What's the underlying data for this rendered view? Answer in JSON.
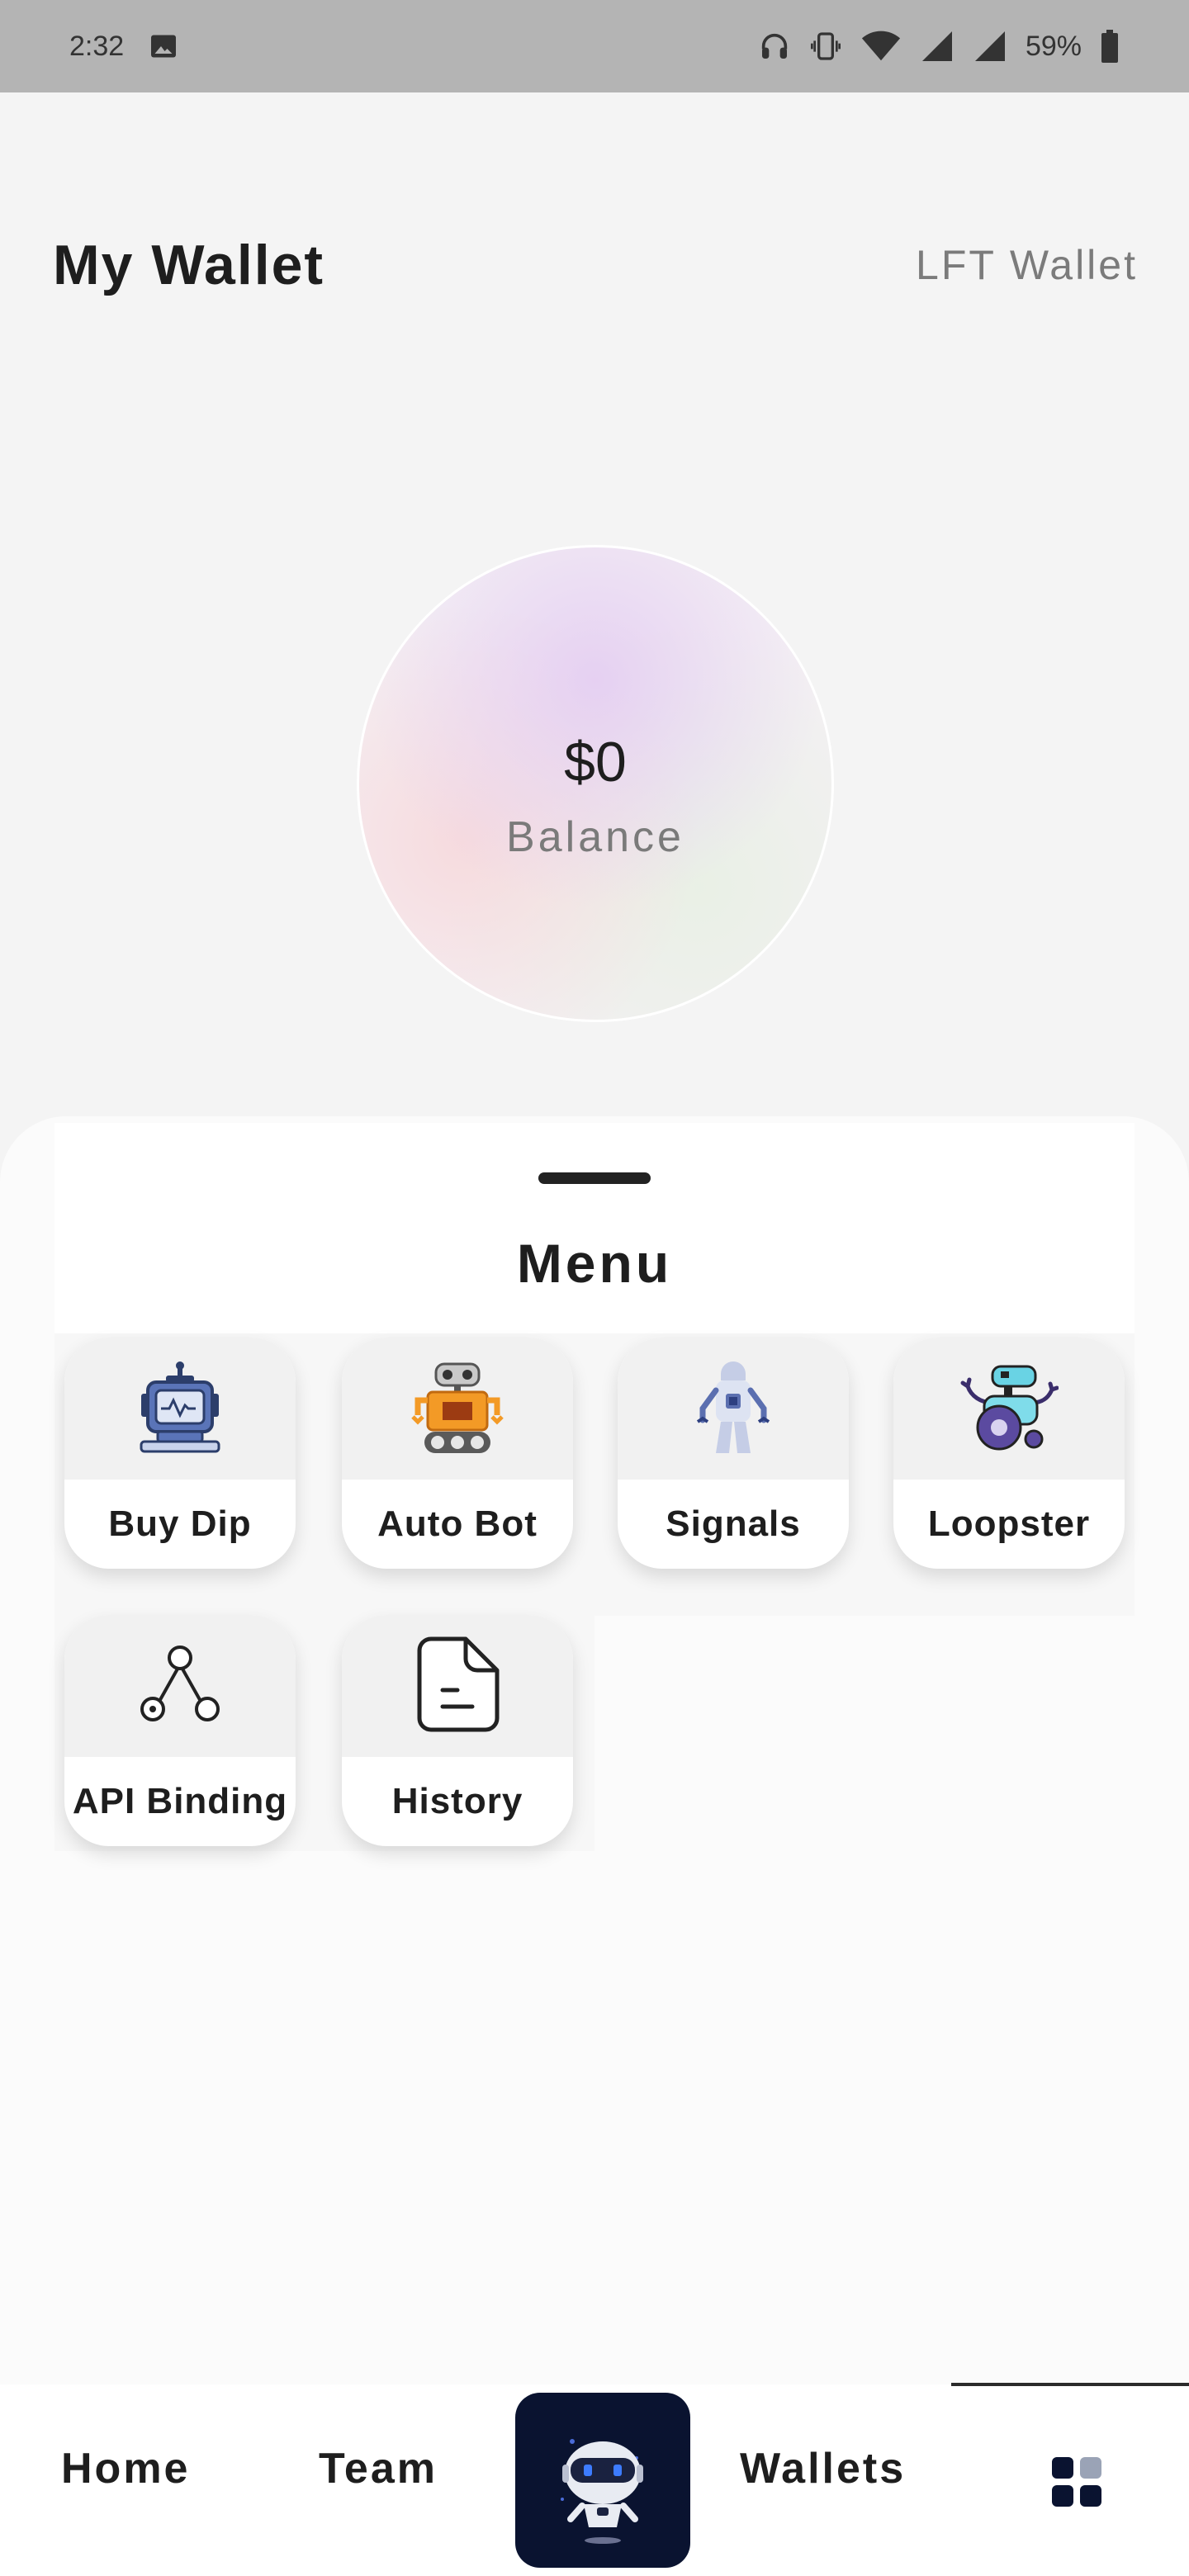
{
  "status_bar": {
    "time": "2:32",
    "battery": "59%"
  },
  "header": {
    "title": "My Wallet",
    "lft_wallet_link": "LFT Wallet"
  },
  "balance": {
    "amount": "$0",
    "label": "Balance"
  },
  "menu": {
    "title": "Menu",
    "items": [
      {
        "label": "Buy Dip",
        "icon": "monitor-robot-icon"
      },
      {
        "label": "Auto Bot",
        "icon": "orange-tracked-robot-icon"
      },
      {
        "label": "Signals",
        "icon": "humanoid-robot-icon"
      },
      {
        "label": "Loopster",
        "icon": "wheel-robot-icon"
      },
      {
        "label": "API Binding",
        "icon": "network-nodes-icon"
      },
      {
        "label": "History",
        "icon": "document-icon"
      }
    ]
  },
  "bottom_nav": {
    "home": "Home",
    "team": "Team",
    "wallets": "Wallets",
    "center_icon": "robot-mascot-icon",
    "menu_icon": "grid-menu-icon"
  },
  "colors": {
    "accent_dark": "#0a1330",
    "status_bar": "#b4b4b4",
    "background": "#f4f4f4"
  }
}
